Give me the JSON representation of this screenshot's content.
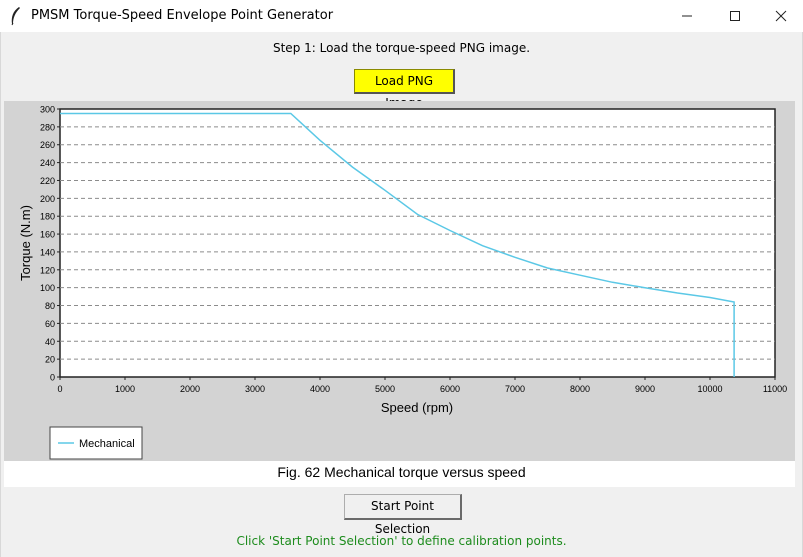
{
  "window": {
    "title": "PMSM Torque-Speed Envelope Point Generator",
    "minimize_icon": "minimize-icon",
    "maximize_icon": "maximize-icon",
    "close_icon": "close-icon"
  },
  "step_label": "Step 1: Load the torque-speed PNG image.",
  "load_button_label": "Load PNG Image",
  "load_button_color": "#ffff00",
  "image": {
    "caption": "Fig. 62 Mechanical torque versus speed"
  },
  "start_button_label": "Start Point Selection",
  "status_text": "Click 'Start Point Selection' to define calibration points.",
  "status_color": "#1e8c1e",
  "chart_data": {
    "type": "line",
    "title": "",
    "xlabel": "Speed (rpm)",
    "ylabel": "Torque (N.m)",
    "xlim": [
      0,
      11000
    ],
    "ylim": [
      0,
      300
    ],
    "x_ticks": [
      0,
      1000,
      2000,
      3000,
      4000,
      5000,
      6000,
      7000,
      8000,
      9000,
      10000,
      11000
    ],
    "y_ticks": [
      0,
      20,
      40,
      60,
      80,
      100,
      120,
      140,
      160,
      180,
      200,
      220,
      240,
      260,
      280,
      300
    ],
    "grid": "horizontal dashed",
    "legend_placement": "bottom-left",
    "series": [
      {
        "name": "Mechanical",
        "color": "#5bc8e6",
        "x": [
          0,
          3550,
          4000,
          4500,
          5000,
          5500,
          6000,
          6500,
          7000,
          7500,
          8000,
          8500,
          9000,
          9500,
          10000,
          10370,
          10370
        ],
        "y": [
          295,
          295,
          265,
          235,
          209,
          182,
          164,
          147,
          134,
          122,
          114,
          106,
          100,
          94,
          89,
          84,
          0
        ]
      }
    ]
  }
}
